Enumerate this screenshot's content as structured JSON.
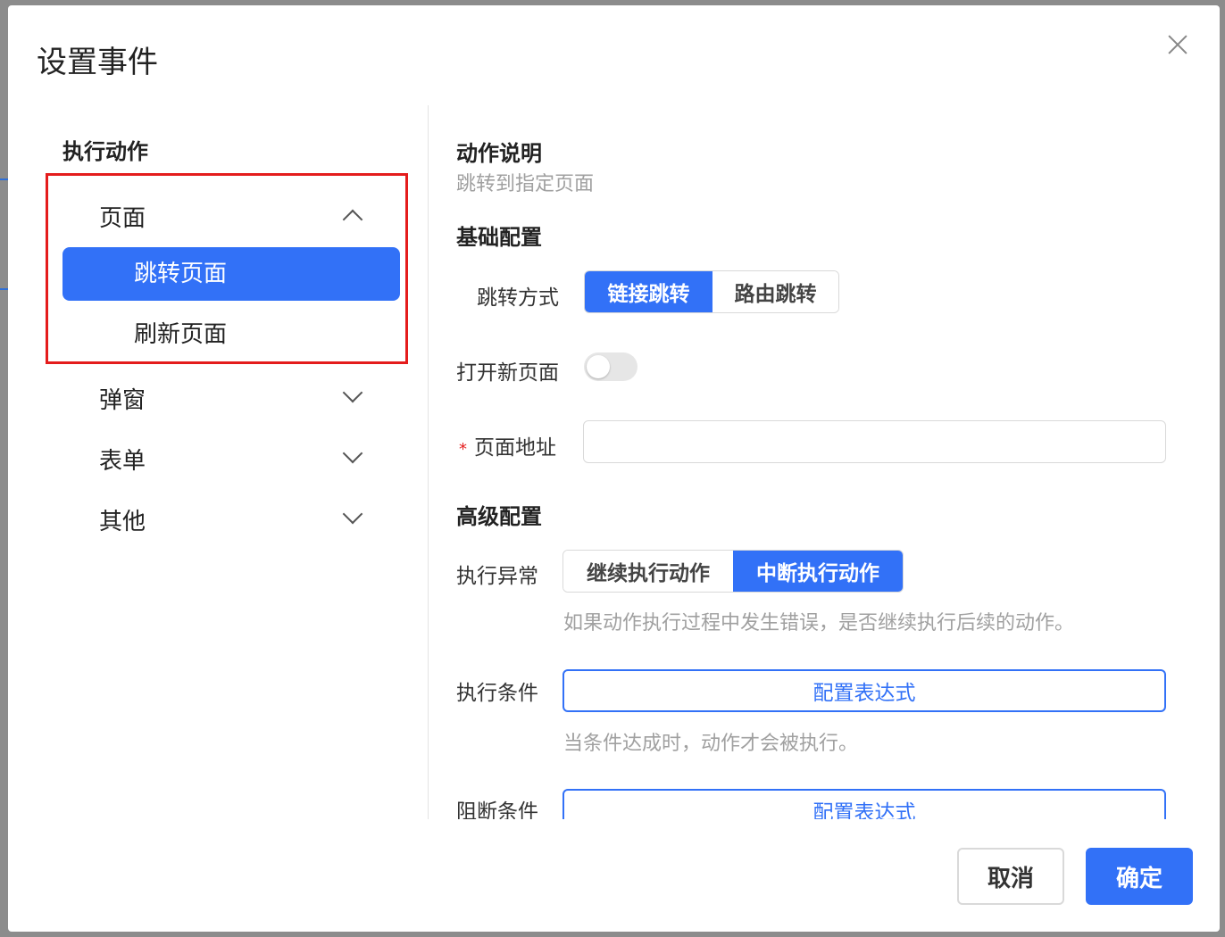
{
  "dialog": {
    "title": "设置事件"
  },
  "left": {
    "title": "执行动作",
    "groups": [
      {
        "label": "页面",
        "expanded": true,
        "items": [
          {
            "label": "跳转页面",
            "active": true
          },
          {
            "label": "刷新页面",
            "active": false
          }
        ]
      },
      {
        "label": "弹窗",
        "expanded": false
      },
      {
        "label": "表单",
        "expanded": false
      },
      {
        "label": "其他",
        "expanded": false
      }
    ]
  },
  "right": {
    "action_desc_title": "动作说明",
    "action_desc": "跳转到指定页面",
    "basic_title": "基础配置",
    "jump_mode_label": "跳转方式",
    "jump_mode_options": [
      "链接跳转",
      "路由跳转"
    ],
    "jump_mode_selected": "链接跳转",
    "open_new_label": "打开新页面",
    "open_new_on": false,
    "url_label": "页面地址",
    "url_required_mark": "*",
    "url_value": "",
    "advanced_title": "高级配置",
    "exception_label": "执行异常",
    "exception_options": [
      "继续执行动作",
      "中断执行动作"
    ],
    "exception_selected": "中断执行动作",
    "exception_hint": "如果动作执行过程中发生错误，是否继续执行后续的动作。",
    "condition_label": "执行条件",
    "condition_button": "配置表达式",
    "condition_hint": "当条件达成时，动作才会被执行。",
    "block_label": "阻断条件",
    "block_button": "配置表达式"
  },
  "footer": {
    "cancel": "取消",
    "confirm": "确定"
  },
  "colors": {
    "primary": "#3271f7",
    "highlight_border": "#e41c1c"
  }
}
